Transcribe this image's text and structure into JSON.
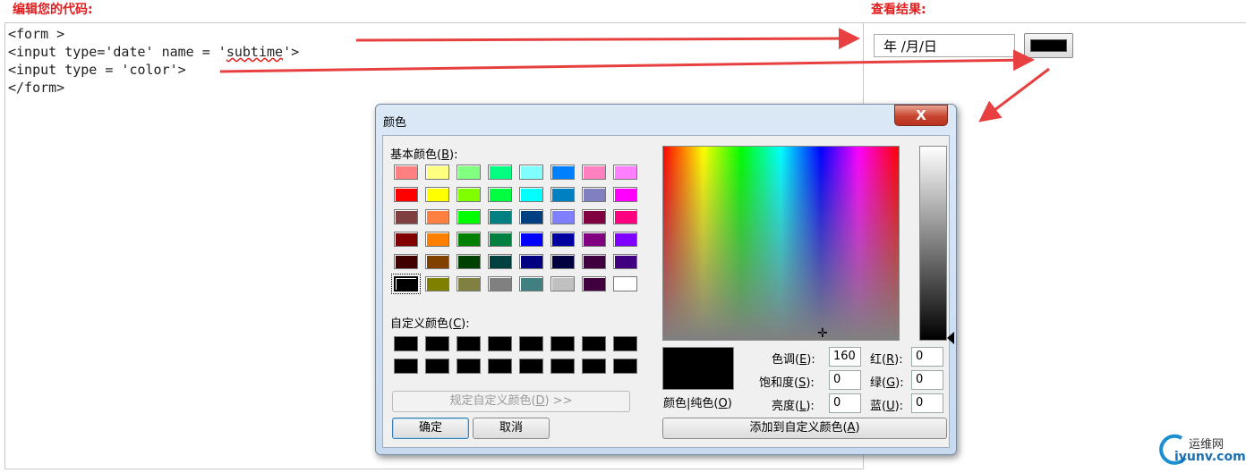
{
  "headers": {
    "edit_code": "编辑您的代码:",
    "view_result": "查看结果:"
  },
  "code_lines": {
    "line1": "<form >",
    "line2_a": "<input type='date' name = '",
    "line2_b": "subtime",
    "line2_c": "'>",
    "line3": "<input type = 'color'>",
    "line4": "</form>"
  },
  "result": {
    "date_placeholder": "年 /月/日",
    "color_value": "#000000"
  },
  "dialog": {
    "title": "颜色",
    "close_symbol": "X",
    "basic_colors_label": "基本颜色(",
    "basic_colors_key": "B",
    "basic_colors_end": "):",
    "basic_colors": [
      "#ff8080",
      "#ffff80",
      "#80ff80",
      "#00ff80",
      "#80ffff",
      "#0080ff",
      "#ff80c0",
      "#ff80ff",
      "#ff0000",
      "#ffff00",
      "#80ff00",
      "#00ff40",
      "#00ffff",
      "#0080c0",
      "#8080c0",
      "#ff00ff",
      "#804040",
      "#ff8040",
      "#00ff00",
      "#008080",
      "#004080",
      "#8080ff",
      "#800040",
      "#ff0080",
      "#800000",
      "#ff8000",
      "#008000",
      "#008040",
      "#0000ff",
      "#0000a0",
      "#800080",
      "#8000ff",
      "#400000",
      "#804000",
      "#004000",
      "#004040",
      "#000080",
      "#000040",
      "#400040",
      "#400080",
      "#000000",
      "#808000",
      "#808040",
      "#808080",
      "#408080",
      "#c0c0c0",
      "#400040",
      "#ffffff"
    ],
    "custom_colors_label": "自定义颜色(",
    "custom_colors_key": "C",
    "custom_colors_end": "):",
    "define_custom_label": "规定自定义颜色(",
    "define_custom_key": "D",
    "define_custom_end": ") >>",
    "ok_label": "确定",
    "cancel_label": "取消",
    "color_solid_a": "颜色|纯色(",
    "color_solid_key": "O",
    "color_solid_end": ")",
    "hue_label": "色调(",
    "hue_key": "E",
    "hue_end": "):",
    "hue_value": "160",
    "sat_label": "饱和度(",
    "sat_key": "S",
    "sat_end": "):",
    "sat_value": "0",
    "lum_label": "亮度(",
    "lum_key": "L",
    "lum_end": "):",
    "lum_value": "0",
    "red_label": "红(",
    "red_key": "R",
    "red_end": "):",
    "red_value": "0",
    "green_label": "绿(",
    "green_key": "G",
    "green_end": "):",
    "green_value": "0",
    "blue_label": "蓝(",
    "blue_key": "U",
    "blue_end": "):",
    "blue_value": "0",
    "add_custom_label": "添加到自定义颜色(",
    "add_custom_key": "A",
    "add_custom_end": ")"
  },
  "watermark": {
    "cn": "运维网",
    "en": "iyunv.com"
  },
  "colors": {
    "arrow": "#e84040",
    "header": "#e02020"
  }
}
